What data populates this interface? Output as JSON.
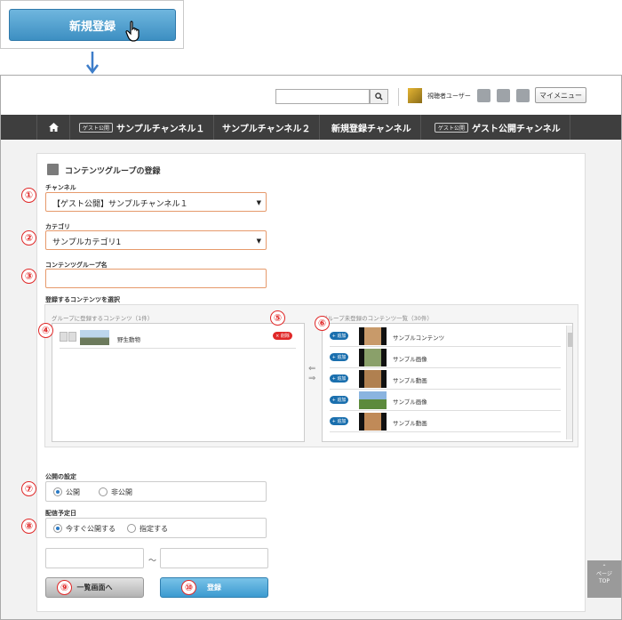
{
  "callout": {
    "button_label": "新規登録"
  },
  "header": {
    "search_placeholder": "",
    "user_name": "視聴者ユーザー",
    "my_menu_label": "マイメニュー"
  },
  "nav": {
    "home_icon": "home-icon",
    "items": [
      {
        "badge": "ゲスト公開",
        "label": "サンプルチャンネル１"
      },
      {
        "badge": "",
        "label": "サンプルチャンネル２"
      },
      {
        "badge": "",
        "label": "新規登録チャンネル"
      },
      {
        "badge": "ゲスト公開",
        "label": "ゲスト公開チャンネル"
      }
    ]
  },
  "form": {
    "title": "コンテンツグループの登録",
    "channel_label": "チャンネル",
    "channel_value": "【ゲスト公開】サンプルチャンネル１",
    "category_label": "カテゴリ",
    "category_value": "サンプルカテゴリ1",
    "group_name_label": "コンテンツグループ名",
    "group_name_value": "",
    "select_contents_label": "登録するコンテンツを選択",
    "registered_list_label": "グループに登録するコンテンツ（1件）",
    "registered_items": [
      {
        "title": "野生動物",
        "delete_label": "× 削除"
      }
    ],
    "unregistered_list_label": "グループ未登録のコンテンツ一覧（30件）",
    "unregistered_items": [
      {
        "title": "サンプルコンテンツ",
        "add_label": "+ 追加"
      },
      {
        "title": "サンプル画像",
        "add_label": "+ 追加"
      },
      {
        "title": "サンプル動画",
        "add_label": "+ 追加"
      },
      {
        "title": "サンプル画像",
        "add_label": "+ 追加"
      },
      {
        "title": "サンプル動画",
        "add_label": "+ 追加"
      }
    ],
    "publish_label": "公開の設定",
    "publish_options": [
      "公開",
      "非公開"
    ],
    "publish_selected": "公開",
    "schedule_label": "配信予定日",
    "schedule_options": [
      "今すぐ公開する",
      "指定する"
    ],
    "schedule_selected": "今すぐ公開する",
    "date_separator": "～",
    "back_button": "一覧画面へ",
    "submit_button": "登録"
  },
  "markers": [
    "①",
    "②",
    "③",
    "④",
    "⑤",
    "⑥",
    "⑦",
    "⑧",
    "⑨",
    "⑩"
  ],
  "page_top": {
    "line1": "ページ",
    "line2": "TOP"
  },
  "colors": {
    "accent": "#3d8fc2",
    "marker": "#e02828",
    "nav_bg": "#3e3e3e",
    "field_border": "#e69a6c"
  }
}
